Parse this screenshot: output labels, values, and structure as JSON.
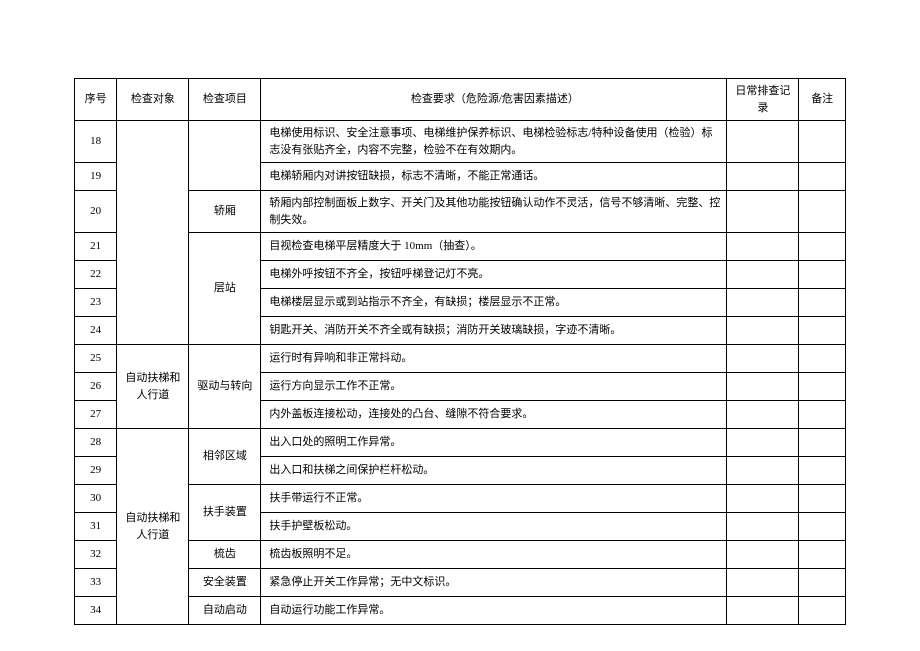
{
  "chart_data": {
    "type": "table",
    "headers": [
      "序号",
      "检查对象",
      "检查项目",
      "检查要求（危险源/危害因素描述）",
      "日常排查记录",
      "备注"
    ],
    "rows": [
      {
        "seq": "18",
        "obj": "",
        "item": "",
        "desc": "电梯使用标识、安全注意事项、电梯维护保养标识、电梯检验标志/特种设备使用（检验）标志没有张贴齐全，内容不完整，检验不在有效期内。",
        "rec": "",
        "note": ""
      },
      {
        "seq": "19",
        "obj": "",
        "item": "",
        "desc": "电梯轿厢内对讲按钮缺损，标志不清晰，不能正常通话。",
        "rec": "",
        "note": ""
      },
      {
        "seq": "20",
        "obj": "",
        "item": "轿厢",
        "desc": "轿厢内部控制面板上数字、开关门及其他功能按钮确认动作不灵活，信号不够清晰、完整、控制失效。",
        "rec": "",
        "note": ""
      },
      {
        "seq": "21",
        "obj": "",
        "item": "",
        "desc": "目视检查电梯平层精度大于 10mm（抽查）。",
        "rec": "",
        "note": ""
      },
      {
        "seq": "22",
        "obj": "",
        "item": "",
        "desc": "电梯外呼按钮不齐全，按钮呼梯登记灯不亮。",
        "rec": "",
        "note": ""
      },
      {
        "seq": "23",
        "obj": "",
        "item": "层站",
        "desc": "电梯楼层显示或到站指示不齐全，有缺损；楼层显示不正常。",
        "rec": "",
        "note": ""
      },
      {
        "seq": "24",
        "obj": "",
        "item": "",
        "desc": "钥匙开关、消防开关不齐全或有缺损；消防开关玻璃缺损，字迹不清晰。",
        "rec": "",
        "note": ""
      },
      {
        "seq": "25",
        "obj": "",
        "item": "",
        "desc": "运行时有异响和非正常抖动。",
        "rec": "",
        "note": ""
      },
      {
        "seq": "26",
        "obj": "自动扶梯和人行道",
        "item": "驱动与转向",
        "desc": "运行方向显示工作不正常。",
        "rec": "",
        "note": ""
      },
      {
        "seq": "27",
        "obj": "",
        "item": "",
        "desc": "内外盖板连接松动，连接处的凸台、缝隙不符合要求。",
        "rec": "",
        "note": ""
      },
      {
        "seq": "28",
        "obj": "",
        "item": "",
        "desc": "出入口处的照明工作异常。",
        "rec": "",
        "note": ""
      },
      {
        "seq": "29",
        "obj": "",
        "item": "相邻区域",
        "desc": "出入口和扶梯之间保护栏杆松动。",
        "rec": "",
        "note": ""
      },
      {
        "seq": "30",
        "obj": "",
        "item": "",
        "desc": "扶手带运行不正常。",
        "rec": "",
        "note": ""
      },
      {
        "seq": "31",
        "obj": "自动扶梯和人行道",
        "item": "扶手装置",
        "desc": "扶手护壁板松动。",
        "rec": "",
        "note": ""
      },
      {
        "seq": "32",
        "obj": "",
        "item": "梳齿",
        "desc": "梳齿板照明不足。",
        "rec": "",
        "note": ""
      },
      {
        "seq": "33",
        "obj": "",
        "item": "安全装置",
        "desc": "紧急停止开关工作异常；无中文标识。",
        "rec": "",
        "note": ""
      },
      {
        "seq": "34",
        "obj": "",
        "item": "自动启动",
        "desc": "自动运行功能工作异常。",
        "rec": "",
        "note": ""
      }
    ]
  }
}
